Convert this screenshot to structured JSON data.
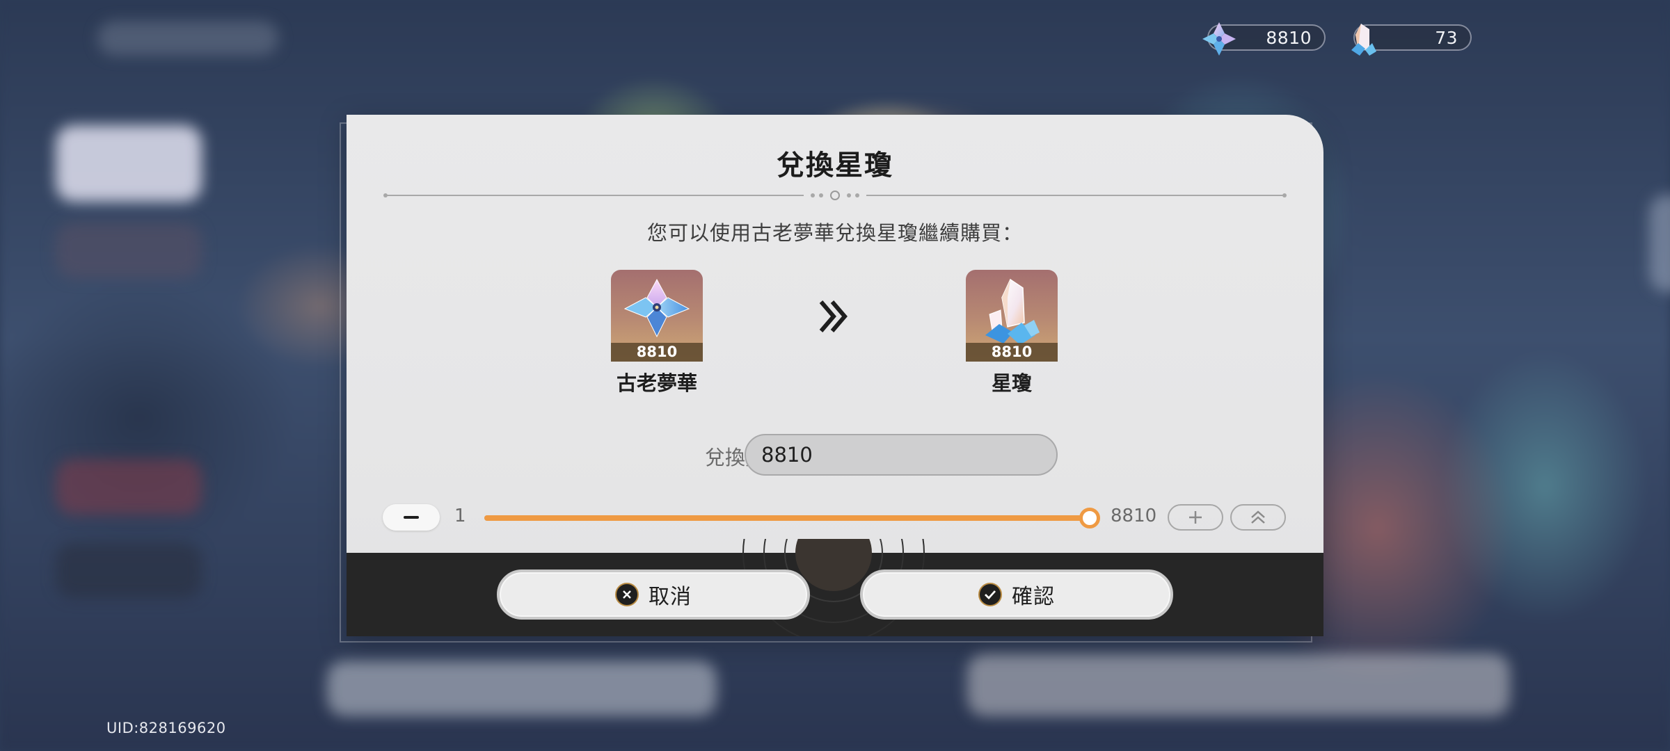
{
  "currencies": [
    {
      "name": "古老夢華",
      "icon": "dream-flower-icon",
      "amount": "8810"
    },
    {
      "name": "星瓊",
      "icon": "stellar-jade-icon",
      "amount": "73"
    }
  ],
  "dialog": {
    "title": "兌換星瓊",
    "subtitle": "您可以使用古老夢華兌換星瓊繼續購買：",
    "from_item": {
      "name": "古老夢華",
      "count": "8810",
      "icon": "dream-flower-icon"
    },
    "to_item": {
      "name": "星瓊",
      "count": "8810",
      "icon": "stellar-jade-icon"
    },
    "quantity_label": "兌換數量：",
    "quantity_value": "8810",
    "slider": {
      "min_label": "1",
      "max_label": "8810",
      "min": 1,
      "max": 8810,
      "value": 8810
    },
    "cancel_label": "取消",
    "confirm_label": "確認"
  },
  "uid": "UID:828169620",
  "colors": {
    "accent": "#ef9a43",
    "footer": "#262626",
    "dialog_bg": "#e8e8e9"
  }
}
